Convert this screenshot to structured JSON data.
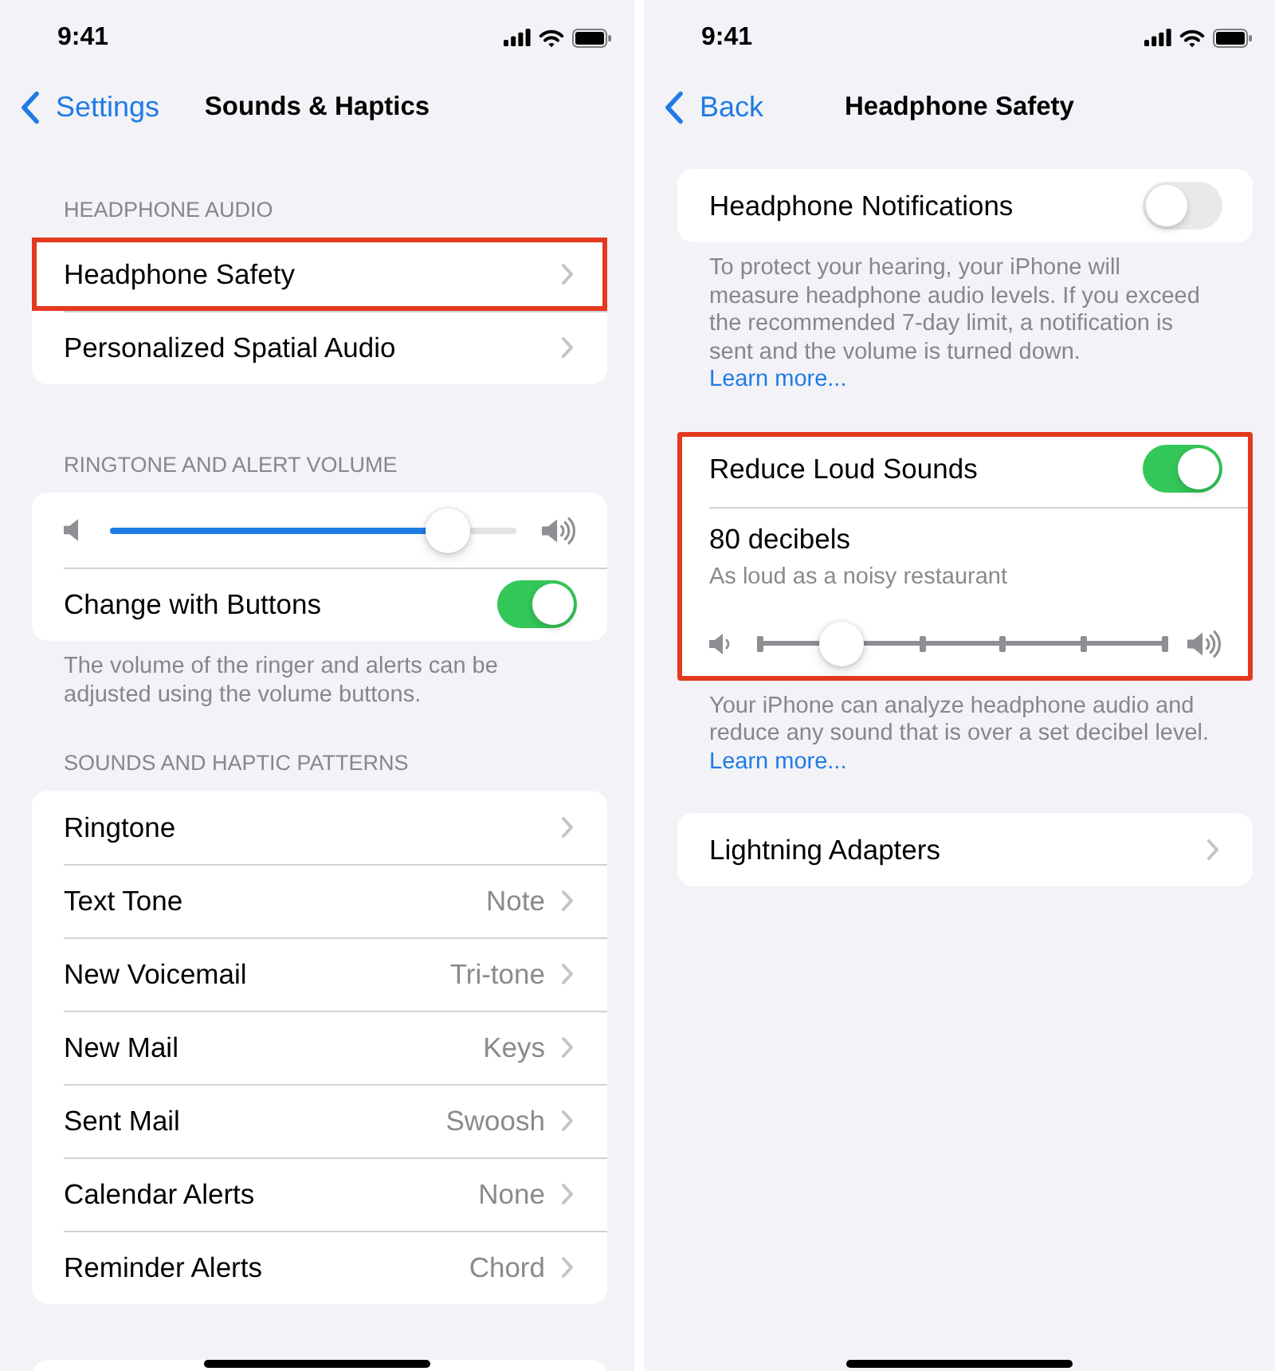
{
  "screens": [
    {
      "status_bar": {
        "time": "9:41"
      },
      "nav": {
        "back": "Settings",
        "title": "Sounds & Haptics"
      },
      "sections": [
        {
          "header": "HEADPHONE AUDIO",
          "highlighted": false,
          "rows": [
            {
              "kind": "link",
              "label": "Headphone Safety",
              "highlighted": true
            },
            {
              "kind": "link",
              "label": "Personalized Spatial Audio",
              "highlighted": false
            }
          ]
        },
        {
          "header": "RINGTONE AND ALERT VOLUME",
          "highlighted": false,
          "rows": [
            {
              "kind": "volume",
              "level": 0.83
            },
            {
              "kind": "toggle",
              "label": "Change with Buttons",
              "on": true
            }
          ],
          "footer": "The volume of the ringer and alerts can be adjusted using the volume buttons."
        },
        {
          "header": "SOUNDS AND HAPTIC PATTERNS",
          "highlighted": false,
          "rows": [
            {
              "kind": "link",
              "label": "Ringtone",
              "highlighted": false
            },
            {
              "kind": "link",
              "label": "Text Tone",
              "value": "Note",
              "highlighted": false
            },
            {
              "kind": "link",
              "label": "New Voicemail",
              "value": "Tri-tone",
              "highlighted": false
            },
            {
              "kind": "link",
              "label": "New Mail",
              "value": "Keys",
              "highlighted": false
            },
            {
              "kind": "link",
              "label": "Sent Mail",
              "value": "Swoosh",
              "highlighted": false
            },
            {
              "kind": "link",
              "label": "Calendar Alerts",
              "value": "None",
              "highlighted": false
            },
            {
              "kind": "link",
              "label": "Reminder Alerts",
              "value": "Chord",
              "highlighted": false
            }
          ]
        }
      ],
      "next_card_peek": true
    },
    {
      "status_bar": {
        "time": "9:41"
      },
      "nav": {
        "back": "Back",
        "title": "Headphone Safety"
      },
      "sections": [
        {
          "highlighted": false,
          "rows": [
            {
              "kind": "toggle",
              "label": "Headphone Notifications",
              "on": false
            }
          ],
          "footer": "To protect your hearing, your iPhone will measure headphone audio levels. If you exceed the recommended 7-day limit, a notification is sent and the volume is turned down.",
          "footer_link": "Learn more..."
        },
        {
          "highlighted": true,
          "rows": [
            {
              "kind": "toggle",
              "label": "Reduce Loud Sounds",
              "on": true
            },
            {
              "kind": "decibel",
              "label": "80 decibels",
              "detail": "As loud as a noisy restaurant",
              "level": 0.2
            }
          ],
          "footer": "Your iPhone can analyze headphone audio and reduce any sound that is over a set decibel level.",
          "footer_link": "Learn more..."
        },
        {
          "highlighted": false,
          "rows": [
            {
              "kind": "link",
              "label": "Lightning Adapters",
              "highlighted": false
            }
          ]
        }
      ],
      "next_card_peek": false
    }
  ]
}
